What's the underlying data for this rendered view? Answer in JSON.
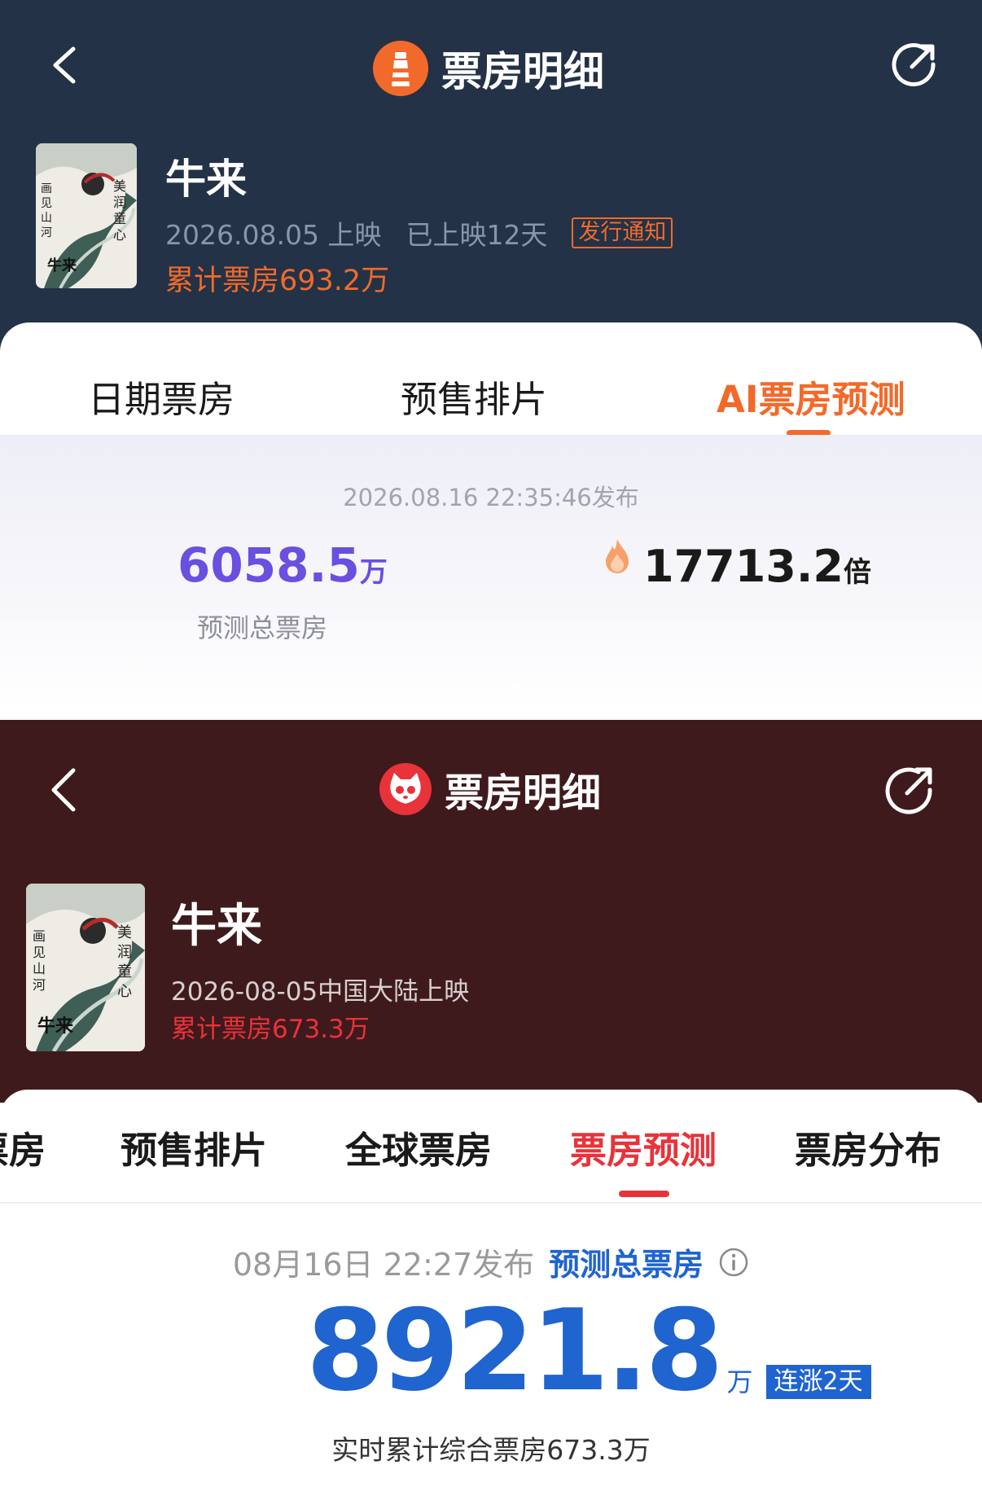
{
  "panel_a": {
    "nav": {
      "title": "票房明细"
    },
    "movie": {
      "title": "牛来",
      "release_date": "2026.08.05 上映",
      "days_showing": "已上映12天",
      "notice_badge": "发行通知",
      "cumulative_box_office": "累计票房693.2万"
    },
    "tabs": [
      {
        "label": "日期票房"
      },
      {
        "label": "预售排片"
      },
      {
        "label": "AI票房预测",
        "active": true
      }
    ],
    "prediction": {
      "publish_time": "2026.08.16 22:35:46发布",
      "total_value": "6058.5",
      "total_unit": "万",
      "total_label": "预测总票房",
      "multiplier_value": "17713.2",
      "multiplier_unit": "倍"
    },
    "colors": {
      "header_bg": "#233246",
      "accent": "#f26a2b",
      "prediction_purple": "#6a4fe0"
    }
  },
  "panel_b": {
    "nav": {
      "title": "票房明细"
    },
    "movie": {
      "title": "牛来",
      "release_info": "2026-08-05中国大陆上映",
      "cumulative_box_office": "累计票房673.3万"
    },
    "tabs": [
      {
        "label": "票房"
      },
      {
        "label": "预售排片"
      },
      {
        "label": "全球票房"
      },
      {
        "label": "票房预测",
        "active": true
      },
      {
        "label": "票房分布"
      }
    ],
    "prediction": {
      "publish_time": "08月16日 22:27发布",
      "title": "预测总票房",
      "value": "8921.8",
      "unit": "万",
      "trend_badge": "连涨2天",
      "realtime_cumulative": "实时累计综合票房673.3万"
    },
    "colors": {
      "header_bg": "#3f1a1c",
      "accent": "#e8333a",
      "prediction_blue": "#1f64cf"
    }
  }
}
